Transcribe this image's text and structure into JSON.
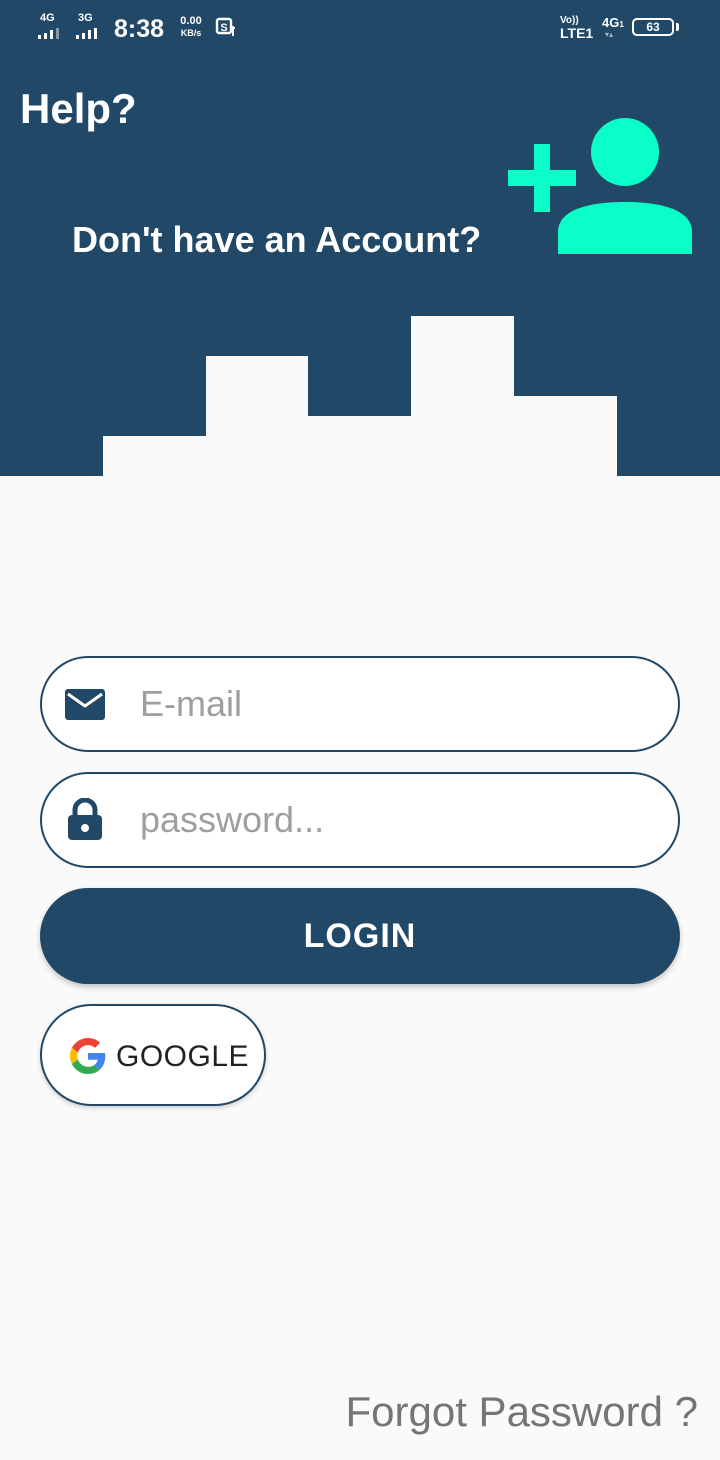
{
  "status_bar": {
    "sim1_network": "4G",
    "sim2_network": "3G",
    "time": "8:38",
    "speed_value": "0.00",
    "speed_unit": "KB/s",
    "volte_top": "Vo))",
    "volte_bottom": "LTE1",
    "data_network": "4G",
    "data_network_sub": "1",
    "battery_level": "63"
  },
  "header": {
    "help_label": "Help?",
    "signup_prompt": "Don't have an Account?",
    "accent_color": "#0affc8",
    "background_color": "#224868"
  },
  "login_form": {
    "email_placeholder": "E-mail",
    "email_value": "",
    "password_placeholder": "password...",
    "password_value": "",
    "login_label": "LOGIN",
    "google_label": "GOOGLE"
  },
  "footer": {
    "forgot_password_label": "Forgot Password ?"
  }
}
